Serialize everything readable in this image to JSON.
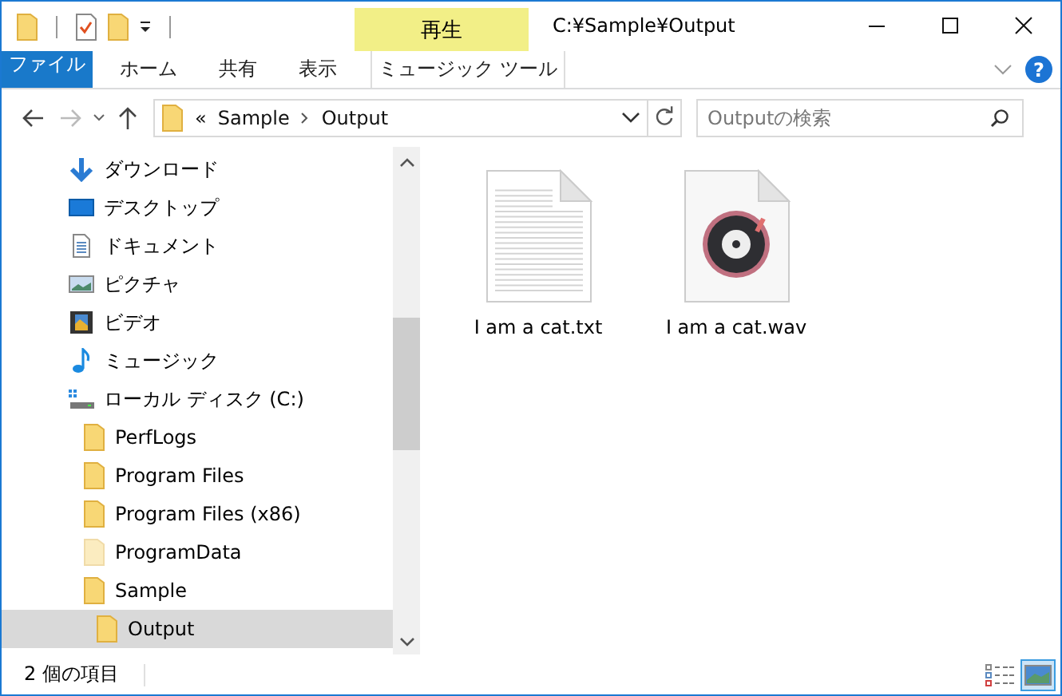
{
  "title_bar": {
    "context_group": "再生",
    "title": "C:¥Sample¥Output"
  },
  "ribbon_tabs": [
    {
      "label": "ファイル",
      "kind": "file"
    },
    {
      "label": "ホーム",
      "kind": "normal"
    },
    {
      "label": "共有",
      "kind": "normal"
    },
    {
      "label": "表示",
      "kind": "normal"
    },
    {
      "label": "ミュージック ツール",
      "kind": "context"
    }
  ],
  "help_button": "?",
  "navigation": {
    "forward_disabled": true
  },
  "address_bar": {
    "overflow": "«",
    "path": [
      "Sample",
      "Output"
    ]
  },
  "search": {
    "placeholder": "Outputの検索"
  },
  "nav_pane": {
    "items": [
      {
        "label": "ダウンロード",
        "kind": "download",
        "selected": false
      },
      {
        "label": "デスクトップ",
        "kind": "desktop",
        "selected": false
      },
      {
        "label": "ドキュメント",
        "kind": "document",
        "selected": false
      },
      {
        "label": "ピクチャ",
        "kind": "pictures",
        "selected": false
      },
      {
        "label": "ビデオ",
        "kind": "video",
        "selected": false
      },
      {
        "label": "ミュージック",
        "kind": "music",
        "selected": false
      },
      {
        "label": "ローカル ディスク (C:)",
        "kind": "drive",
        "selected": false,
        "children": [
          {
            "label": "PerfLogs",
            "kind": "folder",
            "selected": false
          },
          {
            "label": "Program Files",
            "kind": "folder",
            "selected": false
          },
          {
            "label": "Program Files (x86)",
            "kind": "folder",
            "selected": false
          },
          {
            "label": "ProgramData",
            "kind": "folder",
            "hidden": true,
            "selected": false
          },
          {
            "label": "Sample",
            "kind": "folder",
            "selected": false,
            "children": [
              {
                "label": "Output",
                "kind": "folder",
                "selected": true
              }
            ]
          }
        ]
      }
    ]
  },
  "files": [
    {
      "name": "I am a cat.txt",
      "kind": "text"
    },
    {
      "name": "I am a cat.wav",
      "kind": "audio"
    }
  ],
  "status_bar": {
    "count": "2 個の項目",
    "views": [
      {
        "kind": "details",
        "selected": false
      },
      {
        "kind": "large_icons",
        "selected": true
      }
    ]
  }
}
